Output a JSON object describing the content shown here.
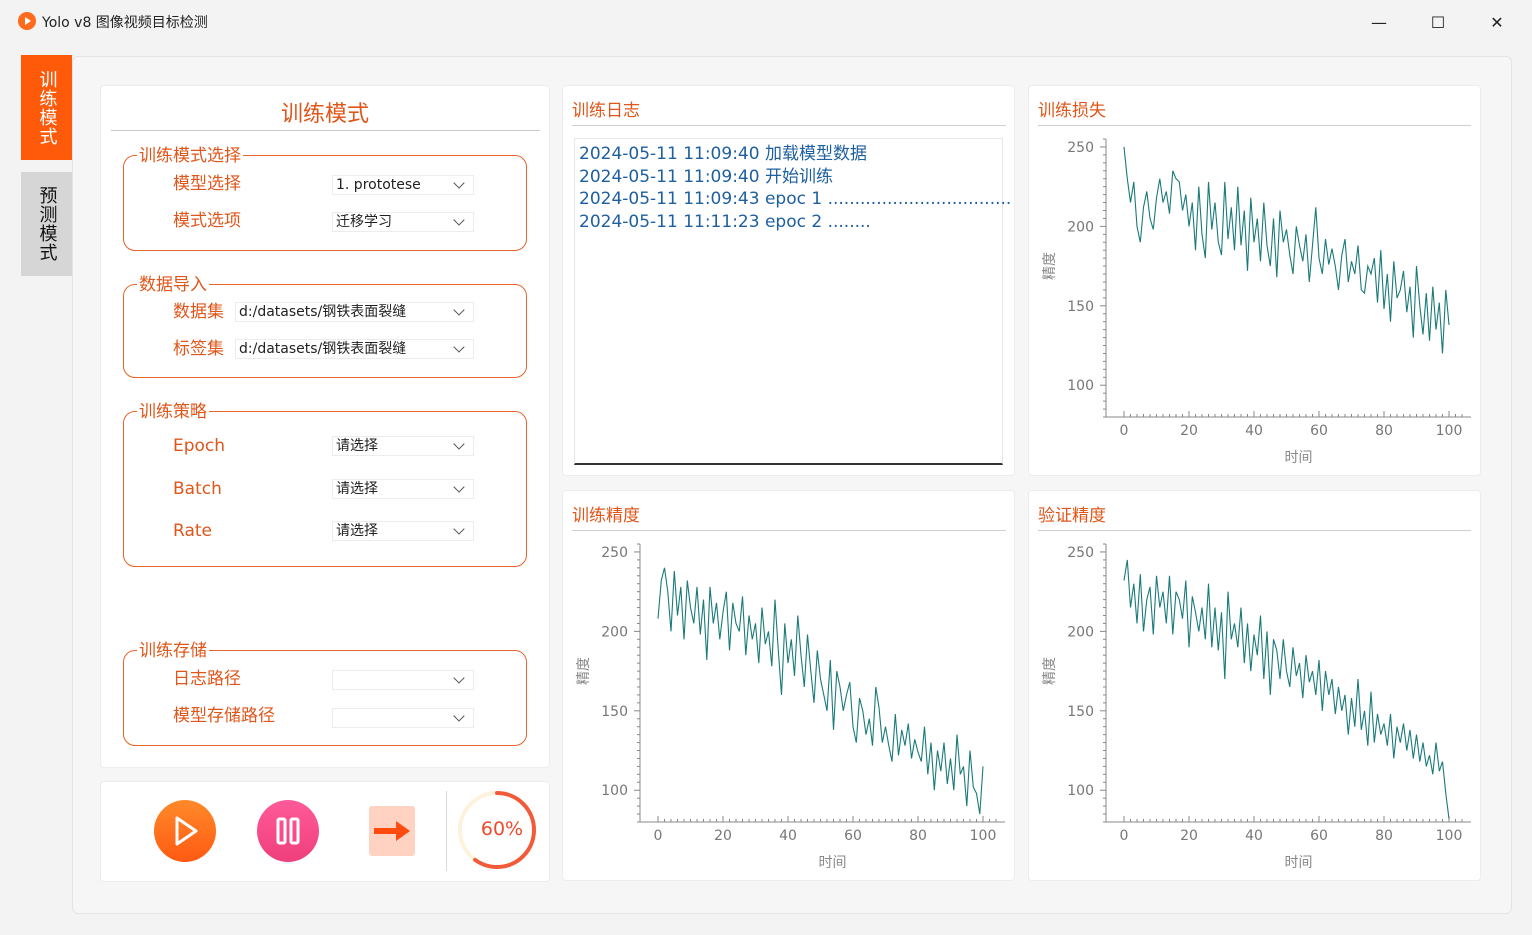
{
  "window": {
    "title": "Yolo v8 图像视频目标检测",
    "minimize_glyph": "—",
    "maximize_glyph": "☐",
    "close_glyph": "✕"
  },
  "tabs": [
    {
      "label": "训练模式",
      "active": true
    },
    {
      "label": "预测模式",
      "active": false
    }
  ],
  "left_panel": {
    "title": "训练模式",
    "groups": {
      "model": {
        "title": "训练模式选择",
        "fields": [
          {
            "label": "模型选择",
            "value": "1. prototese"
          },
          {
            "label": "模式选项",
            "value": "迁移学习"
          }
        ]
      },
      "data": {
        "title": "数据导入",
        "fields": [
          {
            "label": "数据集",
            "value": "d:/datasets/钢铁表面裂缝"
          },
          {
            "label": "标签集",
            "value": "d:/datasets/钢铁表面裂缝"
          }
        ]
      },
      "strategy": {
        "title": "训练策略",
        "fields": [
          {
            "label": "Epoch",
            "value": "请选择"
          },
          {
            "label": "Batch",
            "value": "请选择"
          },
          {
            "label": "Rate",
            "value": "请选择"
          }
        ]
      },
      "storage": {
        "title": "训练存储",
        "fields": [
          {
            "label": "日志路径",
            "value": ""
          },
          {
            "label": "模型存储路径",
            "value": ""
          }
        ]
      }
    }
  },
  "controls": {
    "progress_label": "60%",
    "progress_value": 0.6
  },
  "log": {
    "title": "训练日志",
    "lines": [
      "2024-05-11 11:09:40  加载模型数据",
      "2024-05-11 11:09:40  开始训练",
      "2024-05-11 11:09:43  epoc 1 ..................................",
      "2024-05-11 11:11:23  epoc 2 ........"
    ]
  },
  "colors": {
    "accent": "#e0561a",
    "tab_active": "#ff5a0a",
    "line": "#1a7a7a",
    "log_text": "#1e5fa0"
  },
  "chart_data": [
    {
      "type": "line",
      "title": "训练损失",
      "xlabel": "时间",
      "ylabel": "精度",
      "xlim": [
        0,
        100
      ],
      "ylim": [
        80,
        255
      ],
      "xticks": [
        "0",
        "20",
        "40",
        "60",
        "80",
        "100"
      ],
      "yticks": [
        "100",
        "150",
        "200",
        "250"
      ],
      "series": [
        {
          "values": [
            250,
            230,
            215,
            228,
            200,
            190,
            212,
            222,
            205,
            198,
            218,
            230,
            215,
            222,
            208,
            235,
            230,
            228,
            210,
            220,
            200,
            215,
            185,
            225,
            195,
            180,
            228,
            198,
            215,
            190,
            182,
            228,
            192,
            212,
            185,
            225,
            188,
            210,
            172,
            218,
            190,
            205,
            178,
            215,
            188,
            175,
            205,
            168,
            210,
            190,
            198,
            182,
            170,
            200,
            188,
            178,
            195,
            165,
            188,
            212,
            180,
            170,
            192,
            176,
            186,
            175,
            160,
            182,
            192,
            165,
            178,
            170,
            188,
            160,
            158,
            175,
            170,
            180,
            152,
            185,
            148,
            170,
            140,
            178,
            155,
            160,
            172,
            146,
            162,
            130,
            175,
            150,
            132,
            158,
            128,
            162,
            135,
            152,
            120,
            160,
            138
          ]
        }
      ]
    },
    {
      "type": "line",
      "title": "训练精度",
      "xlabel": "时间",
      "ylabel": "精度",
      "xlim": [
        0,
        100
      ],
      "ylim": [
        80,
        255
      ],
      "xticks": [
        "0",
        "20",
        "40",
        "60",
        "80",
        "100"
      ],
      "yticks": [
        "100",
        "150",
        "200",
        "250"
      ],
      "series": [
        {
          "values": [
            208,
            232,
            240,
            225,
            200,
            238,
            210,
            228,
            195,
            232,
            215,
            205,
            228,
            198,
            220,
            182,
            228,
            205,
            218,
            195,
            212,
            225,
            188,
            218,
            205,
            200,
            222,
            185,
            210,
            195,
            205,
            180,
            215,
            192,
            200,
            178,
            220,
            188,
            160,
            205,
            180,
            195,
            172,
            210,
            185,
            165,
            198,
            175,
            155,
            188,
            170,
            160,
            150,
            182,
            138,
            175,
            165,
            150,
            160,
            168,
            140,
            130,
            158,
            150,
            135,
            145,
            128,
            165,
            152,
            130,
            140,
            128,
            118,
            148,
            122,
            138,
            128,
            142,
            120,
            132,
            124,
            118,
            140,
            110,
            130,
            100,
            125,
            112,
            130,
            104,
            120,
            100,
            135,
            110,
            115,
            90,
            125,
            102,
            98,
            85,
            115
          ]
        }
      ]
    },
    {
      "type": "line",
      "title": "验证精度",
      "xlabel": "时间",
      "ylabel": "精度",
      "xlim": [
        0,
        100
      ],
      "ylim": [
        80,
        255
      ],
      "xticks": [
        "0",
        "20",
        "40",
        "60",
        "80",
        "100"
      ],
      "yticks": [
        "100",
        "150",
        "200",
        "250"
      ],
      "series": [
        {
          "values": [
            232,
            245,
            215,
            230,
            205,
            236,
            200,
            220,
            228,
            198,
            235,
            215,
            225,
            205,
            235,
            198,
            225,
            220,
            208,
            232,
            190,
            222,
            212,
            200,
            215,
            195,
            230,
            190,
            215,
            188,
            212,
            170,
            225,
            195,
            205,
            190,
            215,
            180,
            205,
            175,
            198,
            185,
            210,
            170,
            200,
            160,
            195,
            188,
            170,
            195,
            175,
            165,
            190,
            172,
            180,
            158,
            185,
            168,
            175,
            160,
            182,
            150,
            175,
            160,
            170,
            148,
            165,
            150,
            160,
            135,
            158,
            140,
            170,
            138,
            150,
            128,
            162,
            130,
            148,
            135,
            142,
            128,
            148,
            120,
            140,
            130,
            142,
            125,
            138,
            120,
            135,
            118,
            130,
            115,
            122,
            110,
            130,
            112,
            118,
            98,
            82
          ]
        }
      ]
    }
  ]
}
